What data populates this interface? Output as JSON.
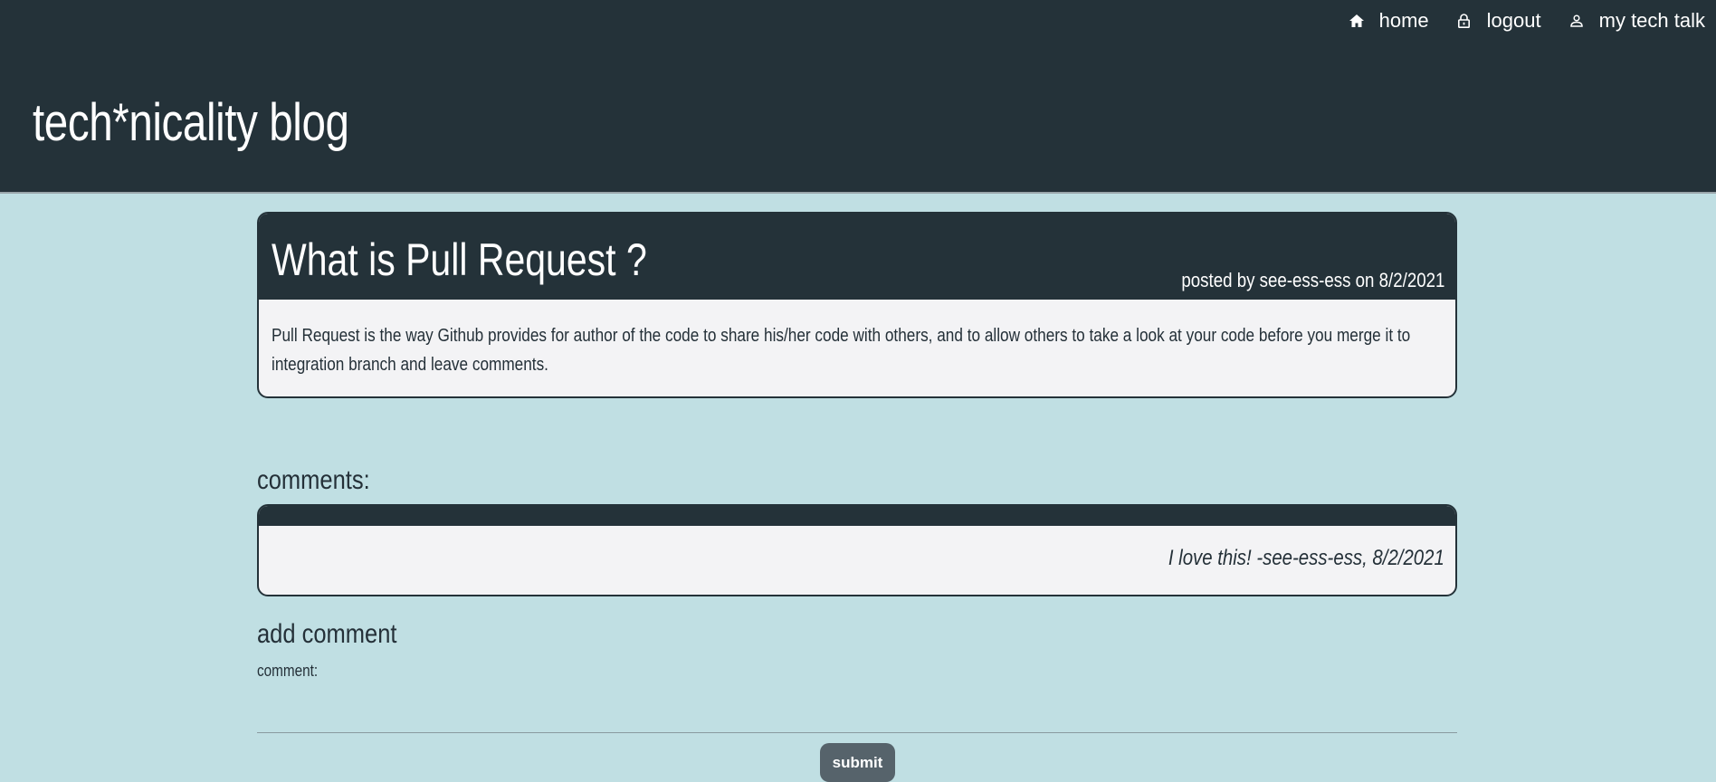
{
  "nav": {
    "items": [
      {
        "label": "home",
        "icon": "home-icon"
      },
      {
        "label": "logout",
        "icon": "lock-icon"
      },
      {
        "label": "my tech talk",
        "icon": "user-icon"
      }
    ]
  },
  "site": {
    "title": "tech*nicality blog"
  },
  "post": {
    "title": "What is Pull Request ?",
    "meta": "posted by see-ess-ess on 8/2/2021",
    "body": "Pull Request is the way Github provides for author of the code to share his/her code with others, and to allow others to take a look at your code before you merge it to integration branch and leave comments."
  },
  "comments": {
    "heading": "comments:",
    "items": [
      {
        "text": "I love this! -see-ess-ess, 8/2/2021"
      }
    ]
  },
  "add_comment": {
    "heading": "add comment",
    "label": "comment:",
    "value": "",
    "submit_label": "submit"
  },
  "colors": {
    "header_bg": "#243239",
    "page_bg": "#c0dfe3",
    "card_bg": "#f3f3f5",
    "button_bg": "#56636b"
  }
}
